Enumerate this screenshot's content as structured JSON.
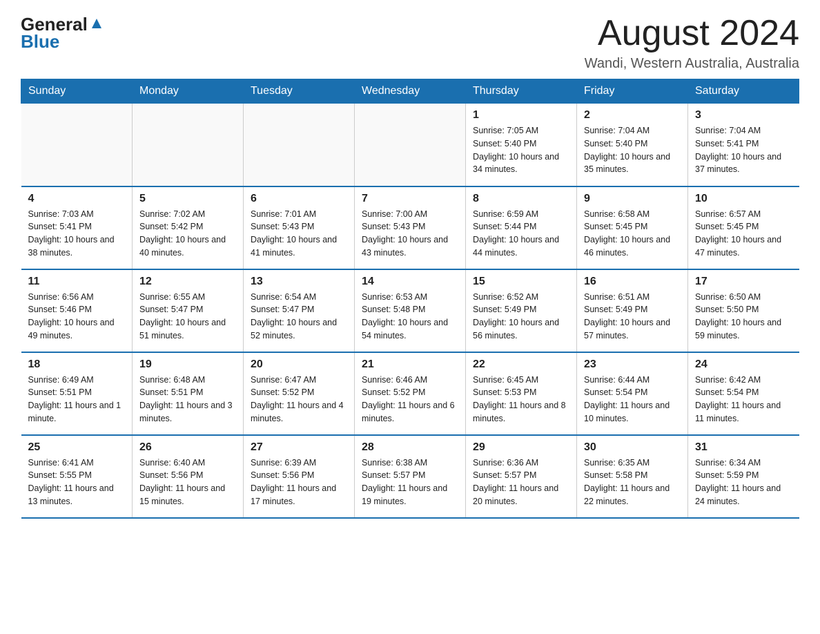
{
  "header": {
    "logo_general": "General",
    "logo_blue": "Blue",
    "title": "August 2024",
    "subtitle": "Wandi, Western Australia, Australia"
  },
  "weekdays": [
    "Sunday",
    "Monday",
    "Tuesday",
    "Wednesday",
    "Thursday",
    "Friday",
    "Saturday"
  ],
  "weeks": [
    [
      {
        "day": "",
        "info": ""
      },
      {
        "day": "",
        "info": ""
      },
      {
        "day": "",
        "info": ""
      },
      {
        "day": "",
        "info": ""
      },
      {
        "day": "1",
        "info": "Sunrise: 7:05 AM\nSunset: 5:40 PM\nDaylight: 10 hours and 34 minutes."
      },
      {
        "day": "2",
        "info": "Sunrise: 7:04 AM\nSunset: 5:40 PM\nDaylight: 10 hours and 35 minutes."
      },
      {
        "day": "3",
        "info": "Sunrise: 7:04 AM\nSunset: 5:41 PM\nDaylight: 10 hours and 37 minutes."
      }
    ],
    [
      {
        "day": "4",
        "info": "Sunrise: 7:03 AM\nSunset: 5:41 PM\nDaylight: 10 hours and 38 minutes."
      },
      {
        "day": "5",
        "info": "Sunrise: 7:02 AM\nSunset: 5:42 PM\nDaylight: 10 hours and 40 minutes."
      },
      {
        "day": "6",
        "info": "Sunrise: 7:01 AM\nSunset: 5:43 PM\nDaylight: 10 hours and 41 minutes."
      },
      {
        "day": "7",
        "info": "Sunrise: 7:00 AM\nSunset: 5:43 PM\nDaylight: 10 hours and 43 minutes."
      },
      {
        "day": "8",
        "info": "Sunrise: 6:59 AM\nSunset: 5:44 PM\nDaylight: 10 hours and 44 minutes."
      },
      {
        "day": "9",
        "info": "Sunrise: 6:58 AM\nSunset: 5:45 PM\nDaylight: 10 hours and 46 minutes."
      },
      {
        "day": "10",
        "info": "Sunrise: 6:57 AM\nSunset: 5:45 PM\nDaylight: 10 hours and 47 minutes."
      }
    ],
    [
      {
        "day": "11",
        "info": "Sunrise: 6:56 AM\nSunset: 5:46 PM\nDaylight: 10 hours and 49 minutes."
      },
      {
        "day": "12",
        "info": "Sunrise: 6:55 AM\nSunset: 5:47 PM\nDaylight: 10 hours and 51 minutes."
      },
      {
        "day": "13",
        "info": "Sunrise: 6:54 AM\nSunset: 5:47 PM\nDaylight: 10 hours and 52 minutes."
      },
      {
        "day": "14",
        "info": "Sunrise: 6:53 AM\nSunset: 5:48 PM\nDaylight: 10 hours and 54 minutes."
      },
      {
        "day": "15",
        "info": "Sunrise: 6:52 AM\nSunset: 5:49 PM\nDaylight: 10 hours and 56 minutes."
      },
      {
        "day": "16",
        "info": "Sunrise: 6:51 AM\nSunset: 5:49 PM\nDaylight: 10 hours and 57 minutes."
      },
      {
        "day": "17",
        "info": "Sunrise: 6:50 AM\nSunset: 5:50 PM\nDaylight: 10 hours and 59 minutes."
      }
    ],
    [
      {
        "day": "18",
        "info": "Sunrise: 6:49 AM\nSunset: 5:51 PM\nDaylight: 11 hours and 1 minute."
      },
      {
        "day": "19",
        "info": "Sunrise: 6:48 AM\nSunset: 5:51 PM\nDaylight: 11 hours and 3 minutes."
      },
      {
        "day": "20",
        "info": "Sunrise: 6:47 AM\nSunset: 5:52 PM\nDaylight: 11 hours and 4 minutes."
      },
      {
        "day": "21",
        "info": "Sunrise: 6:46 AM\nSunset: 5:52 PM\nDaylight: 11 hours and 6 minutes."
      },
      {
        "day": "22",
        "info": "Sunrise: 6:45 AM\nSunset: 5:53 PM\nDaylight: 11 hours and 8 minutes."
      },
      {
        "day": "23",
        "info": "Sunrise: 6:44 AM\nSunset: 5:54 PM\nDaylight: 11 hours and 10 minutes."
      },
      {
        "day": "24",
        "info": "Sunrise: 6:42 AM\nSunset: 5:54 PM\nDaylight: 11 hours and 11 minutes."
      }
    ],
    [
      {
        "day": "25",
        "info": "Sunrise: 6:41 AM\nSunset: 5:55 PM\nDaylight: 11 hours and 13 minutes."
      },
      {
        "day": "26",
        "info": "Sunrise: 6:40 AM\nSunset: 5:56 PM\nDaylight: 11 hours and 15 minutes."
      },
      {
        "day": "27",
        "info": "Sunrise: 6:39 AM\nSunset: 5:56 PM\nDaylight: 11 hours and 17 minutes."
      },
      {
        "day": "28",
        "info": "Sunrise: 6:38 AM\nSunset: 5:57 PM\nDaylight: 11 hours and 19 minutes."
      },
      {
        "day": "29",
        "info": "Sunrise: 6:36 AM\nSunset: 5:57 PM\nDaylight: 11 hours and 20 minutes."
      },
      {
        "day": "30",
        "info": "Sunrise: 6:35 AM\nSunset: 5:58 PM\nDaylight: 11 hours and 22 minutes."
      },
      {
        "day": "31",
        "info": "Sunrise: 6:34 AM\nSunset: 5:59 PM\nDaylight: 11 hours and 24 minutes."
      }
    ]
  ]
}
